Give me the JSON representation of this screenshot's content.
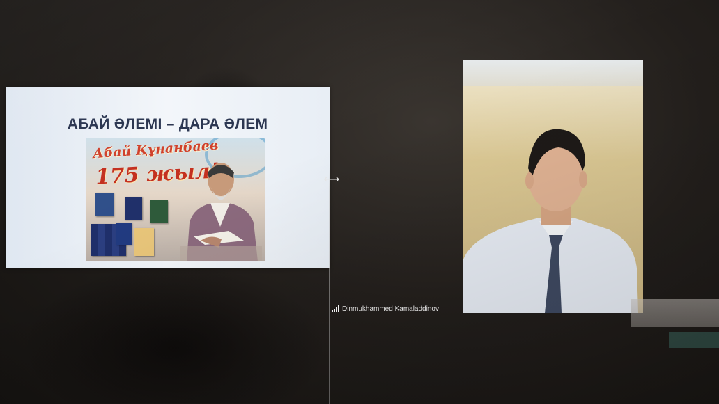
{
  "slide": {
    "title": "АБАЙ ӘЛЕМІ – ДАРА ӘЛЕМ",
    "poster_script": "Абай Құнанбаев",
    "poster_years": "175 жыл!"
  },
  "participant": {
    "name": "Dinmukhammed Kamaladdinov"
  },
  "colors": {
    "slide_title": "#2a3550",
    "poster_text": "#c42f1f",
    "tile_background": "#dcc994"
  },
  "icons": {
    "resize_handle": "double-arrow-horizontal",
    "signal": "signal-bars-icon"
  }
}
